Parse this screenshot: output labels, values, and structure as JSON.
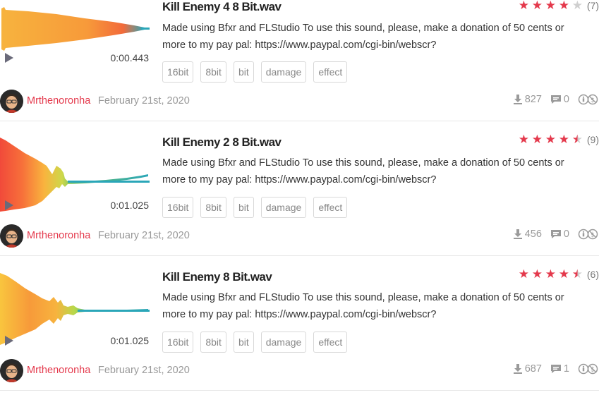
{
  "sounds": [
    {
      "title": "Kill Enemy 4 8 Bit.wav",
      "duration": "0:00.443",
      "rating": 4,
      "rating_count": "(7)",
      "description": "Made using Bfxr and FLStudio To use this sound, please, make a donation of 50 cents or more to my pay pal: https://www.paypal.com/cgi-bin/webscr?",
      "tags": [
        "16bit",
        "8bit",
        "bit",
        "damage",
        "effect"
      ],
      "username": "Mrthenoronha",
      "date": "February 21st, 2020",
      "downloads": "827",
      "comments": "0"
    },
    {
      "title": "Kill Enemy 2 8 Bit.wav",
      "duration": "0:01.025",
      "rating": 4.5,
      "rating_count": "(9)",
      "description": "Made using Bfxr and FLStudio To use this sound, please, make a donation of 50 cents or more to my pay pal: https://www.paypal.com/cgi-bin/webscr?",
      "tags": [
        "16bit",
        "8bit",
        "bit",
        "damage",
        "effect"
      ],
      "username": "Mrthenoronha",
      "date": "February 21st, 2020",
      "downloads": "456",
      "comments": "0"
    },
    {
      "title": "Kill Enemy 8 Bit.wav",
      "duration": "0:01.025",
      "rating": 4.5,
      "rating_count": "(6)",
      "description": "Made using Bfxr and FLStudio To use this sound, please, make a donation of 50 cents or more to my pay pal: https://www.paypal.com/cgi-bin/webscr?",
      "tags": [
        "16bit",
        "8bit",
        "bit",
        "damage",
        "effect"
      ],
      "username": "Mrthenoronha",
      "date": "February 21st, 2020",
      "downloads": "687",
      "comments": "1"
    }
  ],
  "colors": {
    "accent": "#e4394c",
    "wave_hot": "#f14a3a",
    "wave_warm": "#f9a43a",
    "wave_cool": "#2aa6b8",
    "muted": "#999999"
  },
  "icons": {
    "play": "play-icon",
    "download": "download-icon",
    "comment": "comment-icon",
    "license": "cc-attribution-noncommercial-icon"
  }
}
